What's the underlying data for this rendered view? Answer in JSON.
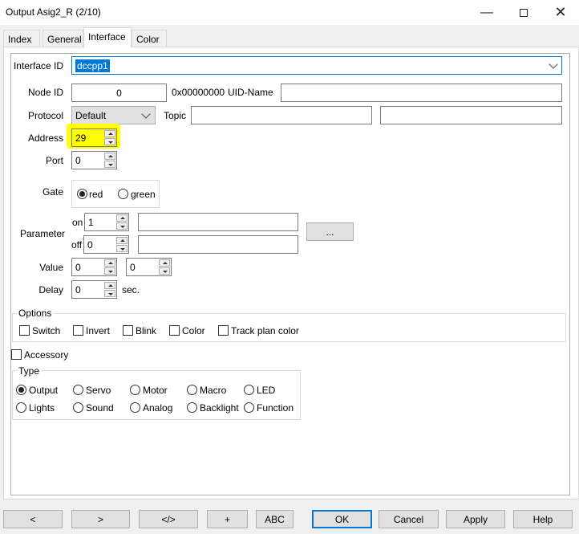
{
  "window": {
    "title": "Output Asig2_R (2/10)"
  },
  "tabs": [
    "Index",
    "General",
    "Interface",
    "Color"
  ],
  "interface": {
    "interface_id_label": "Interface ID",
    "interface_id_value": "dccpp1",
    "node_id_label": "Node ID",
    "node_id_value": "0",
    "node_hex": "0x00000000",
    "uid_name_label": "UID-Name",
    "uid_name_value": "",
    "protocol_label": "Protocol",
    "protocol_value": "Default",
    "topic_label": "Topic",
    "topic_value_1": "",
    "topic_value_2": "",
    "address_label": "Address",
    "address_value": "29",
    "port_label": "Port",
    "port_value": "0",
    "gate_label": "Gate",
    "gate_options": [
      "red",
      "green"
    ],
    "gate_selected": "red",
    "parameter_label": "Parameter",
    "param_on_label": "on",
    "param_on_value": "1",
    "param_on_text": "",
    "param_off_label": "off",
    "param_off_value": "0",
    "param_off_text": "",
    "param_button": "...",
    "value_label": "Value",
    "value_1": "0",
    "value_2": "0",
    "delay_label": "Delay",
    "delay_value": "0",
    "delay_unit": "sec."
  },
  "options": {
    "label": "Options",
    "items": [
      {
        "label": "Switch",
        "checked": false
      },
      {
        "label": "Invert",
        "checked": false
      },
      {
        "label": "Blink",
        "checked": false
      },
      {
        "label": "Color",
        "checked": false
      },
      {
        "label": "Track plan color",
        "checked": false
      }
    ]
  },
  "accessory": {
    "label": "Accessory",
    "checked": false
  },
  "type": {
    "label": "Type",
    "options": [
      "Output",
      "Servo",
      "Motor",
      "Macro",
      "LED",
      "Lights",
      "Sound",
      "Analog",
      "Backlight",
      "Function"
    ],
    "selected": "Output"
  },
  "footer": [
    "<",
    ">",
    "</>",
    "+",
    "ABC",
    "OK",
    "Cancel",
    "Apply",
    "Help"
  ],
  "colors": {
    "highlight": "#ffff00",
    "accent": "#0078d7"
  }
}
